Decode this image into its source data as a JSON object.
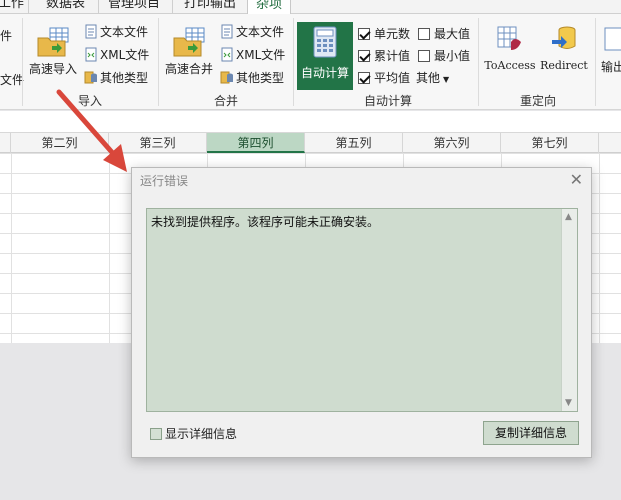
{
  "tabs": [
    {
      "label": "工作"
    },
    {
      "label": "数据表"
    },
    {
      "label": "管理项目"
    },
    {
      "label": "打印输出"
    },
    {
      "label": "杂项"
    }
  ],
  "ribbon": {
    "left_cut": {
      "line1": "件",
      "line2": "文件"
    },
    "import_group": {
      "big_label": "高速导入",
      "items": [
        "文本文件",
        "XML文件",
        "其他类型"
      ],
      "label": "导入"
    },
    "merge_group": {
      "big_label": "高速合并",
      "items": [
        "文本文件",
        "XML文件",
        "其他类型"
      ],
      "label": "合并"
    },
    "calc_group": {
      "big_label": "自动计算",
      "checks": [
        {
          "label": "单元数",
          "checked": true
        },
        {
          "label": "最大值",
          "checked": false
        },
        {
          "label": "累计值",
          "checked": true
        },
        {
          "label": "最小值",
          "checked": false
        },
        {
          "label": "平均值",
          "checked": true
        }
      ],
      "other_label": "其他",
      "label": "自动计算"
    },
    "redirect_group": {
      "items": [
        "ToAccess",
        "Redirect"
      ],
      "label": "重定向"
    },
    "right_cut": {
      "label": "输出"
    }
  },
  "columns": [
    "第二列",
    "第三列",
    "第四列",
    "第五列",
    "第六列",
    "第七列"
  ],
  "selected_column": "第四列",
  "dialog": {
    "title": "运行错误",
    "message": "未找到提供程序。该程序可能未正确安装。",
    "show_details_label": "显示详细信息",
    "copy_button_label": "复制详细信息"
  }
}
